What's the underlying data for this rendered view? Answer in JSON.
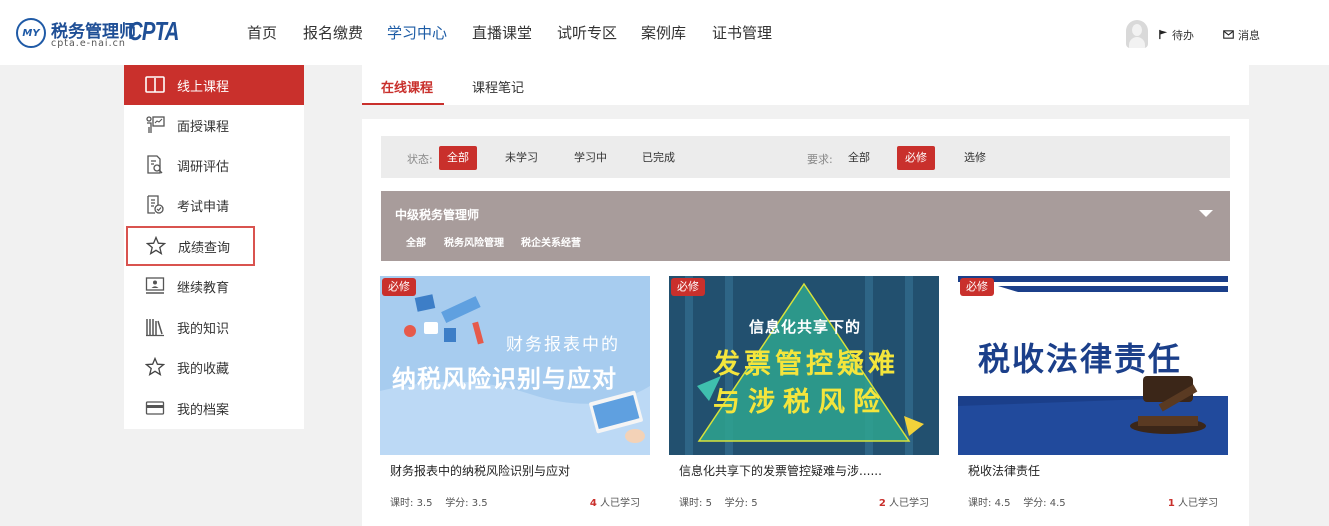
{
  "brand": {
    "seal_text": "MY",
    "name": "税务管理师",
    "domain": "cpta.e-nai.cn",
    "logo_text": "CPTA"
  },
  "nav": {
    "items": [
      "首页",
      "报名缴费",
      "学习中心",
      "直播课堂",
      "试听专区",
      "案例库",
      "证书管理"
    ],
    "active_index": 2
  },
  "header_actions": {
    "todo_label": "待办",
    "message_label": "消息"
  },
  "sidebar": {
    "items": [
      {
        "label": "线上课程",
        "icon": "open-book-icon",
        "state": "active"
      },
      {
        "label": "面授课程",
        "icon": "teacher-board-icon",
        "state": "normal"
      },
      {
        "label": "调研评估",
        "icon": "document-search-icon",
        "state": "normal"
      },
      {
        "label": "考试申请",
        "icon": "exam-check-icon",
        "state": "normal"
      },
      {
        "label": "成绩查询",
        "icon": "star-icon",
        "state": "highlighted"
      },
      {
        "label": "继续教育",
        "icon": "monitor-person-icon",
        "state": "normal"
      },
      {
        "label": "我的知识",
        "icon": "bookshelf-icon",
        "state": "normal"
      },
      {
        "label": "我的收藏",
        "icon": "star-icon",
        "state": "normal"
      },
      {
        "label": "我的档案",
        "icon": "card-icon",
        "state": "normal"
      }
    ]
  },
  "tabs": {
    "items": [
      "在线课程",
      "课程笔记"
    ],
    "active_index": 0
  },
  "filter": {
    "status_label": "状态:",
    "status_options": [
      "全部",
      "未学习",
      "学习中",
      "已完成"
    ],
    "status_selected": 0,
    "requirement_label": "要求:",
    "requirement_options": [
      "全部",
      "必修",
      "选修"
    ],
    "requirement_selected": 1
  },
  "category": {
    "title": "中级税务管理师",
    "tags": [
      "全部",
      "税务风险管理",
      "税企关系经营"
    ]
  },
  "courses": [
    {
      "badge": "必修",
      "cover_line1": "财务报表中的",
      "cover_line2": "纳税风险识别与应对",
      "title": "财务报表中的纳税风险识别与应对",
      "hours_label": "课时:",
      "hours": "3.5",
      "credits_label": "学分:",
      "credits": "3.5",
      "learners": "4",
      "learners_suffix": "人已学习"
    },
    {
      "badge": "必修",
      "cover_line1": "信息化共享下的",
      "cover_line2": "发票管控疑难",
      "cover_line3": "与涉税风险",
      "title": "信息化共享下的发票管控疑难与涉......",
      "hours_label": "课时:",
      "hours": "5",
      "credits_label": "学分:",
      "credits": "5",
      "learners": "2",
      "learners_suffix": "人已学习"
    },
    {
      "badge": "必修",
      "cover_line1": "税收法律责任",
      "title": "税收法律责任",
      "hours_label": "课时:",
      "hours": "4.5",
      "credits_label": "学分:",
      "credits": "4.5",
      "learners": "1",
      "learners_suffix": "人已学习"
    }
  ],
  "colors": {
    "accent": "#c9302c",
    "brand_blue": "#1f4f96",
    "category_bg": "#a89c9b"
  }
}
